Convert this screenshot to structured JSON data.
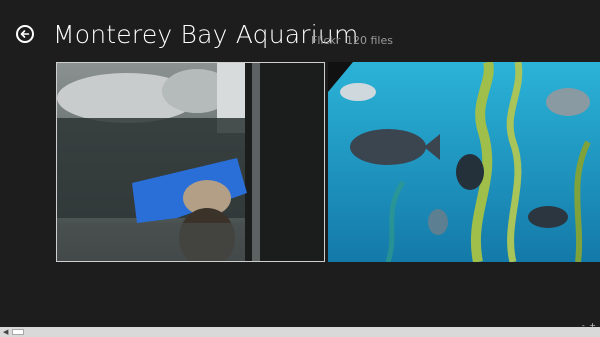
{
  "header": {
    "title": "Monterey Bay Aquarium",
    "source": "Flickr",
    "count": "120 files"
  },
  "icons": {
    "back": "back-arrow-icon",
    "scroll_left": "chevron-left-icon",
    "zoom": "semantic-zoom-icon"
  },
  "photos": [
    {
      "name": "sea-lion-photo",
      "description_tag": "sea lion at glass"
    },
    {
      "name": "kelp-forest-photo",
      "description_tag": "fish in kelp forest"
    }
  ],
  "colors": {
    "background": "#1d1d1d",
    "water_blue": "#1aa7cf",
    "selection_border": "#cfcfcf"
  }
}
